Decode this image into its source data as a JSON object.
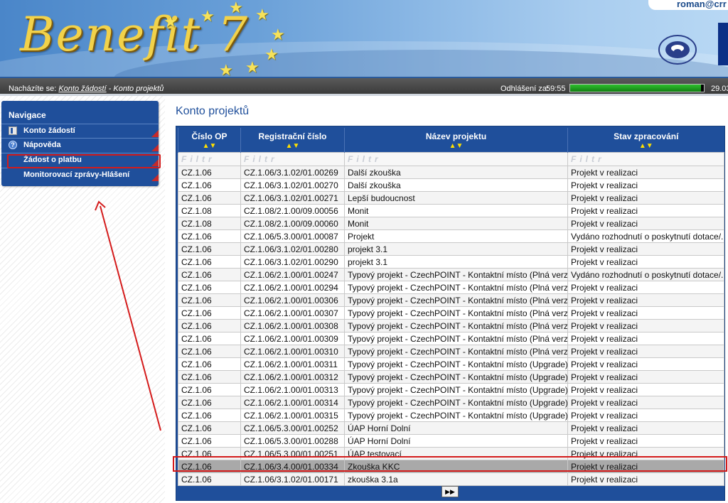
{
  "header": {
    "logo_text": "Benefit 7",
    "user": "roman@crr"
  },
  "breadcrumb": {
    "prefix": "Nacházíte se:",
    "link": "Konto žádostí",
    "separator": " - ",
    "current": "Konto projektů"
  },
  "session": {
    "logout_label": "Odhlášení za:",
    "timer": "59:55",
    "progress_fraction": 0.98,
    "date": "29.03"
  },
  "nav": {
    "title": "Navigace",
    "items": [
      {
        "label": "Konto žádostí",
        "icon": "book-icon"
      },
      {
        "label": "Nápověda",
        "icon": "help-icon"
      },
      {
        "label": "Žádost o platbu",
        "icon": ""
      },
      {
        "label": "Monitorovací zprávy-Hlášení",
        "icon": ""
      }
    ]
  },
  "main": {
    "title": "Konto projektů",
    "columns": [
      "Číslo OP",
      "Registrační číslo",
      "Název projektu",
      "Stav zpracování"
    ],
    "sort_glyph": "▲▼",
    "filter_placeholder": "Filtr",
    "rows": [
      [
        "CZ.1.06",
        "CZ.1.06/3.1.02/01.00269",
        "Další zkouška",
        "Projekt v realizaci"
      ],
      [
        "CZ.1.06",
        "CZ.1.06/3.1.02/01.00270",
        "Další zkouška",
        "Projekt v realizaci"
      ],
      [
        "CZ.1.06",
        "CZ.1.06/3.1.02/01.00271",
        "Lepší budoucnost",
        "Projekt v realizaci"
      ],
      [
        "CZ.1.08",
        "CZ.1.08/2.1.00/09.00056",
        "Monit",
        "Projekt v realizaci"
      ],
      [
        "CZ.1.08",
        "CZ.1.08/2.1.00/09.00060",
        "Monit",
        "Projekt v realizaci"
      ],
      [
        "CZ.1.06",
        "CZ.1.06/5.3.00/01.00087",
        "Projekt",
        "Vydáno rozhodnutí o poskytnutí dotace/..."
      ],
      [
        "CZ.1.06",
        "CZ.1.06/3.1.02/01.00280",
        "projekt 3.1",
        "Projekt v realizaci"
      ],
      [
        "CZ.1.06",
        "CZ.1.06/3.1.02/01.00290",
        "projekt 3.1",
        "Projekt v realizaci"
      ],
      [
        "CZ.1.06",
        "CZ.1.06/2.1.00/01.00247",
        "Typový projekt - CzechPOINT - Kontaktní místo (Plná verze)",
        "Vydáno rozhodnutí o poskytnutí dotace/..."
      ],
      [
        "CZ.1.06",
        "CZ.1.06/2.1.00/01.00294",
        "Typový projekt - CzechPOINT - Kontaktní místo (Plná verze)",
        "Projekt v realizaci"
      ],
      [
        "CZ.1.06",
        "CZ.1.06/2.1.00/01.00306",
        "Typový projekt - CzechPOINT - Kontaktní místo (Plná verze)",
        "Projekt v realizaci"
      ],
      [
        "CZ.1.06",
        "CZ.1.06/2.1.00/01.00307",
        "Typový projekt - CzechPOINT - Kontaktní místo (Plná verze)",
        "Projekt v realizaci"
      ],
      [
        "CZ.1.06",
        "CZ.1.06/2.1.00/01.00308",
        "Typový projekt - CzechPOINT - Kontaktní místo (Plná verze)",
        "Projekt v realizaci"
      ],
      [
        "CZ.1.06",
        "CZ.1.06/2.1.00/01.00309",
        "Typový projekt - CzechPOINT - Kontaktní místo (Plná verze)",
        "Projekt v realizaci"
      ],
      [
        "CZ.1.06",
        "CZ.1.06/2.1.00/01.00310",
        "Typový projekt - CzechPOINT - Kontaktní místo (Plná verze)",
        "Projekt v realizaci"
      ],
      [
        "CZ.1.06",
        "CZ.1.06/2.1.00/01.00311",
        "Typový projekt - CzechPOINT - Kontaktní místo (Upgrade)",
        "Projekt v realizaci"
      ],
      [
        "CZ.1.06",
        "CZ.1.06/2.1.00/01.00312",
        "Typový projekt - CzechPOINT - Kontaktní místo (Upgrade)",
        "Projekt v realizaci"
      ],
      [
        "CZ.1.06",
        "CZ.1.06/2.1.00/01.00313",
        "Typový projekt - CzechPOINT - Kontaktní místo (Upgrade)",
        "Projekt v realizaci"
      ],
      [
        "CZ.1.06",
        "CZ.1.06/2.1.00/01.00314",
        "Typový projekt - CzechPOINT - Kontaktní místo (Upgrade)",
        "Projekt v realizaci"
      ],
      [
        "CZ.1.06",
        "CZ.1.06/2.1.00/01.00315",
        "Typový projekt - CzechPOINT - Kontaktní místo (Upgrade)",
        "Projekt v realizaci"
      ],
      [
        "CZ.1.06",
        "CZ.1.06/5.3.00/01.00252",
        "ÚAP Horní Dolní",
        "Projekt v realizaci"
      ],
      [
        "CZ.1.06",
        "CZ.1.06/5.3.00/01.00288",
        "ÚAP Horní Dolní",
        "Projekt v realizaci"
      ],
      [
        "CZ.1.06",
        "CZ.1.06/5.3.00/01.00251",
        "ÚAP testovací",
        "Projekt v realizaci"
      ],
      [
        "CZ.1.06",
        "CZ.1.06/3.4.00/01.00334",
        "Zkouška KKC",
        "Projekt v realizaci"
      ],
      [
        "CZ.1.06",
        "CZ.1.06/3.1.02/01.00171",
        "zkouška 3.1a",
        "Projekt v realizaci"
      ]
    ],
    "selected_row": 23,
    "pager_next": "▶▶"
  },
  "colors": {
    "primary_blue": "#1f4f9b",
    "highlight_red": "#d41b1b",
    "progress_green": "#1fa01f"
  }
}
